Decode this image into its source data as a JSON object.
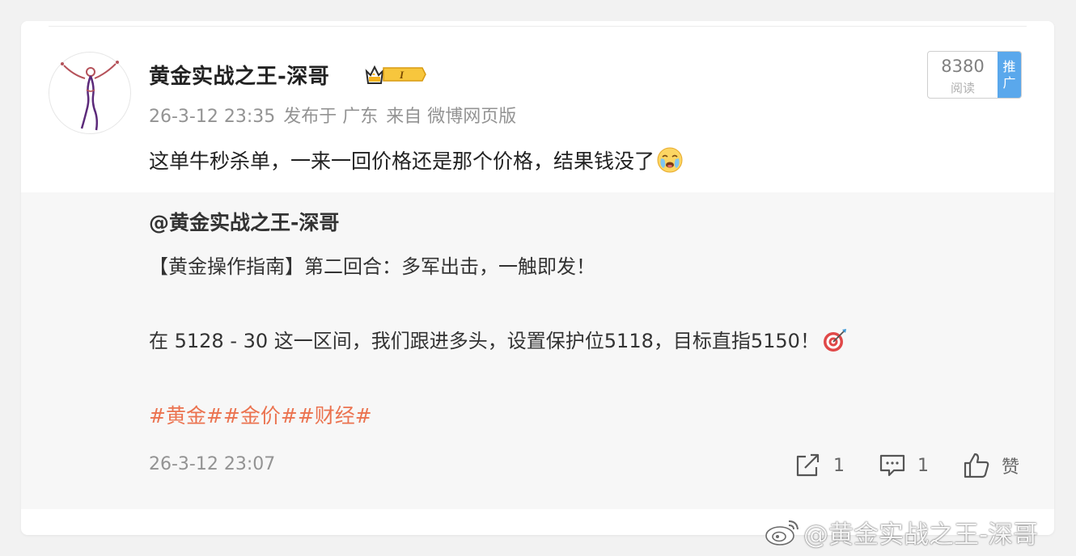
{
  "post": {
    "author": "黄金实战之王-深哥",
    "timestamp": "26-3-12 23:35",
    "location": "发布于 广东",
    "source": "来自 微博网页版",
    "text": "这单牛秒杀单，一来一回价格还是那个价格，结果钱没了",
    "emoji": "crying-face-icon"
  },
  "read_stats": {
    "count": "8380",
    "label": "阅读",
    "promote_line1": "推",
    "promote_line2": "广"
  },
  "original": {
    "author": "@黄金实战之王-深哥",
    "line1": "【黄金操作指南】第二回合：多军出击，一触即发！",
    "line2": "在 5128 - 30 这一区间，我们跟进多头，设置保护位5118，目标直指5150！",
    "hashtags": [
      "#黄金#",
      "#金价#",
      "#财经#"
    ],
    "timestamp": "26-3-12 23:07"
  },
  "actions": {
    "repost_count": "1",
    "comment_count": "1",
    "like_label": "赞"
  },
  "watermark": "@黄金实战之王-深哥",
  "colors": {
    "hashtag": "#eb7350",
    "promote": "#5aa8ec",
    "meta": "#939393"
  }
}
